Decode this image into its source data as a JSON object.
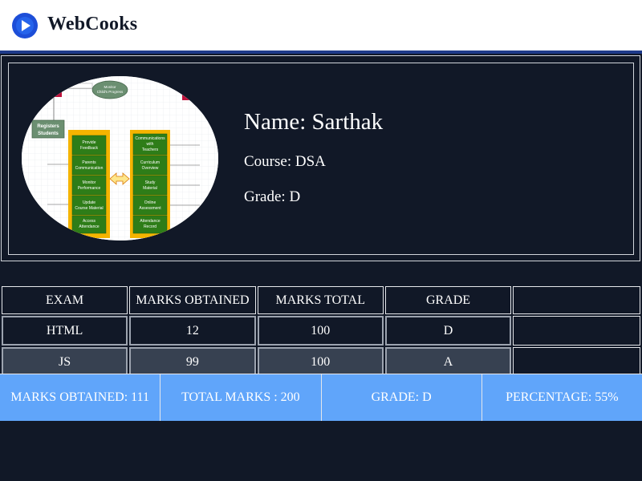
{
  "brand": {
    "name": "WebCooks",
    "logo_icon": "play-circle-icon",
    "accent": "#1d4ed8"
  },
  "profile": {
    "name_text": "Name: Sarthak",
    "course_text": "Course: DSA",
    "grade_text": "Grade: D",
    "photo": {
      "labels": {
        "monitor": "Monitor Child's Progress",
        "registers": "Registers Students",
        "left_items": [
          "Provide Feedback",
          "Parents Communication",
          "Monitor Performance",
          "Update Course Material",
          "Access Attendance"
        ],
        "right_items": [
          "Communications with Teachers",
          "Curriculum Overview",
          "Study Material",
          "Online Assessment",
          "Attendance Record"
        ]
      }
    }
  },
  "table": {
    "headers": [
      "EXAM",
      "MARKS OBTAINED",
      "MARKS TOTAL",
      "GRADE"
    ],
    "rows": [
      [
        "HTML",
        "12",
        "100",
        "D"
      ],
      [
        "JS",
        "99",
        "100",
        "A"
      ]
    ]
  },
  "summary": {
    "marks_obtained": "MARKS OBTAINED: 111",
    "total_marks": "TOTAL MARKS : 200",
    "grade": "GRADE: D",
    "percentage": "PERCENTAGE: 55%"
  }
}
